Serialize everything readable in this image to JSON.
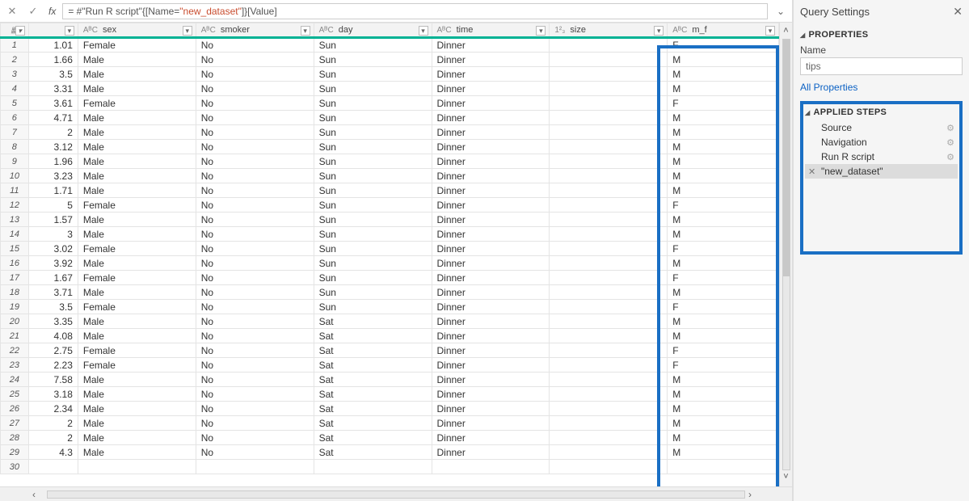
{
  "formula": {
    "prefix": "= #\"Run R script\"{[Name=",
    "string": "\"new_dataset\"",
    "suffix": "]}[Value]"
  },
  "columns": [
    {
      "type": "",
      "name": "",
      "cls": "col-first"
    },
    {
      "type": "AᴮC",
      "name": "sex",
      "cls": "col-std"
    },
    {
      "type": "AᴮC",
      "name": "smoker",
      "cls": "col-std"
    },
    {
      "type": "AᴮC",
      "name": "day",
      "cls": "col-std"
    },
    {
      "type": "AᴮC",
      "name": "time",
      "cls": "col-std"
    },
    {
      "type": "1²₃",
      "name": "size",
      "cls": "col-std"
    },
    {
      "type": "AᴮC",
      "name": "m_f",
      "cls": "col-mf"
    }
  ],
  "rows": [
    {
      "n": 1,
      "c0": "1.01",
      "sex": "Female",
      "smoker": "No",
      "day": "Sun",
      "time": "Dinner",
      "size": "",
      "mf": "F"
    },
    {
      "n": 2,
      "c0": "1.66",
      "sex": "Male",
      "smoker": "No",
      "day": "Sun",
      "time": "Dinner",
      "size": "",
      "mf": "M"
    },
    {
      "n": 3,
      "c0": "3.5",
      "sex": "Male",
      "smoker": "No",
      "day": "Sun",
      "time": "Dinner",
      "size": "",
      "mf": "M"
    },
    {
      "n": 4,
      "c0": "3.31",
      "sex": "Male",
      "smoker": "No",
      "day": "Sun",
      "time": "Dinner",
      "size": "",
      "mf": "M"
    },
    {
      "n": 5,
      "c0": "3.61",
      "sex": "Female",
      "smoker": "No",
      "day": "Sun",
      "time": "Dinner",
      "size": "",
      "mf": "F"
    },
    {
      "n": 6,
      "c0": "4.71",
      "sex": "Male",
      "smoker": "No",
      "day": "Sun",
      "time": "Dinner",
      "size": "",
      "mf": "M"
    },
    {
      "n": 7,
      "c0": "2",
      "sex": "Male",
      "smoker": "No",
      "day": "Sun",
      "time": "Dinner",
      "size": "",
      "mf": "M"
    },
    {
      "n": 8,
      "c0": "3.12",
      "sex": "Male",
      "smoker": "No",
      "day": "Sun",
      "time": "Dinner",
      "size": "",
      "mf": "M"
    },
    {
      "n": 9,
      "c0": "1.96",
      "sex": "Male",
      "smoker": "No",
      "day": "Sun",
      "time": "Dinner",
      "size": "",
      "mf": "M"
    },
    {
      "n": 10,
      "c0": "3.23",
      "sex": "Male",
      "smoker": "No",
      "day": "Sun",
      "time": "Dinner",
      "size": "",
      "mf": "M"
    },
    {
      "n": 11,
      "c0": "1.71",
      "sex": "Male",
      "smoker": "No",
      "day": "Sun",
      "time": "Dinner",
      "size": "",
      "mf": "M"
    },
    {
      "n": 12,
      "c0": "5",
      "sex": "Female",
      "smoker": "No",
      "day": "Sun",
      "time": "Dinner",
      "size": "",
      "mf": "F"
    },
    {
      "n": 13,
      "c0": "1.57",
      "sex": "Male",
      "smoker": "No",
      "day": "Sun",
      "time": "Dinner",
      "size": "",
      "mf": "M"
    },
    {
      "n": 14,
      "c0": "3",
      "sex": "Male",
      "smoker": "No",
      "day": "Sun",
      "time": "Dinner",
      "size": "",
      "mf": "M"
    },
    {
      "n": 15,
      "c0": "3.02",
      "sex": "Female",
      "smoker": "No",
      "day": "Sun",
      "time": "Dinner",
      "size": "",
      "mf": "F"
    },
    {
      "n": 16,
      "c0": "3.92",
      "sex": "Male",
      "smoker": "No",
      "day": "Sun",
      "time": "Dinner",
      "size": "",
      "mf": "M"
    },
    {
      "n": 17,
      "c0": "1.67",
      "sex": "Female",
      "smoker": "No",
      "day": "Sun",
      "time": "Dinner",
      "size": "",
      "mf": "F"
    },
    {
      "n": 18,
      "c0": "3.71",
      "sex": "Male",
      "smoker": "No",
      "day": "Sun",
      "time": "Dinner",
      "size": "",
      "mf": "M"
    },
    {
      "n": 19,
      "c0": "3.5",
      "sex": "Female",
      "smoker": "No",
      "day": "Sun",
      "time": "Dinner",
      "size": "",
      "mf": "F"
    },
    {
      "n": 20,
      "c0": "3.35",
      "sex": "Male",
      "smoker": "No",
      "day": "Sat",
      "time": "Dinner",
      "size": "",
      "mf": "M"
    },
    {
      "n": 21,
      "c0": "4.08",
      "sex": "Male",
      "smoker": "No",
      "day": "Sat",
      "time": "Dinner",
      "size": "",
      "mf": "M"
    },
    {
      "n": 22,
      "c0": "2.75",
      "sex": "Female",
      "smoker": "No",
      "day": "Sat",
      "time": "Dinner",
      "size": "",
      "mf": "F"
    },
    {
      "n": 23,
      "c0": "2.23",
      "sex": "Female",
      "smoker": "No",
      "day": "Sat",
      "time": "Dinner",
      "size": "",
      "mf": "F"
    },
    {
      "n": 24,
      "c0": "7.58",
      "sex": "Male",
      "smoker": "No",
      "day": "Sat",
      "time": "Dinner",
      "size": "",
      "mf": "M"
    },
    {
      "n": 25,
      "c0": "3.18",
      "sex": "Male",
      "smoker": "No",
      "day": "Sat",
      "time": "Dinner",
      "size": "",
      "mf": "M"
    },
    {
      "n": 26,
      "c0": "2.34",
      "sex": "Male",
      "smoker": "No",
      "day": "Sat",
      "time": "Dinner",
      "size": "",
      "mf": "M"
    },
    {
      "n": 27,
      "c0": "2",
      "sex": "Male",
      "smoker": "No",
      "day": "Sat",
      "time": "Dinner",
      "size": "",
      "mf": "M"
    },
    {
      "n": 28,
      "c0": "2",
      "sex": "Male",
      "smoker": "No",
      "day": "Sat",
      "time": "Dinner",
      "size": "",
      "mf": "M"
    },
    {
      "n": 29,
      "c0": "4.3",
      "sex": "Male",
      "smoker": "No",
      "day": "Sat",
      "time": "Dinner",
      "size": "",
      "mf": "M"
    },
    {
      "n": 30,
      "c0": "",
      "sex": "",
      "smoker": "",
      "day": "",
      "time": "",
      "size": "",
      "mf": ""
    }
  ],
  "side": {
    "title": "Query Settings",
    "properties": "PROPERTIES",
    "name_label": "Name",
    "name_value": "tips",
    "all_props": "All Properties",
    "applied": "APPLIED STEPS",
    "steps": [
      {
        "label": "Source",
        "gear": true
      },
      {
        "label": "Navigation",
        "gear": true
      },
      {
        "label": "Run R script",
        "gear": true
      },
      {
        "label": "\"new_dataset\"",
        "gear": false,
        "selected": true
      }
    ]
  }
}
